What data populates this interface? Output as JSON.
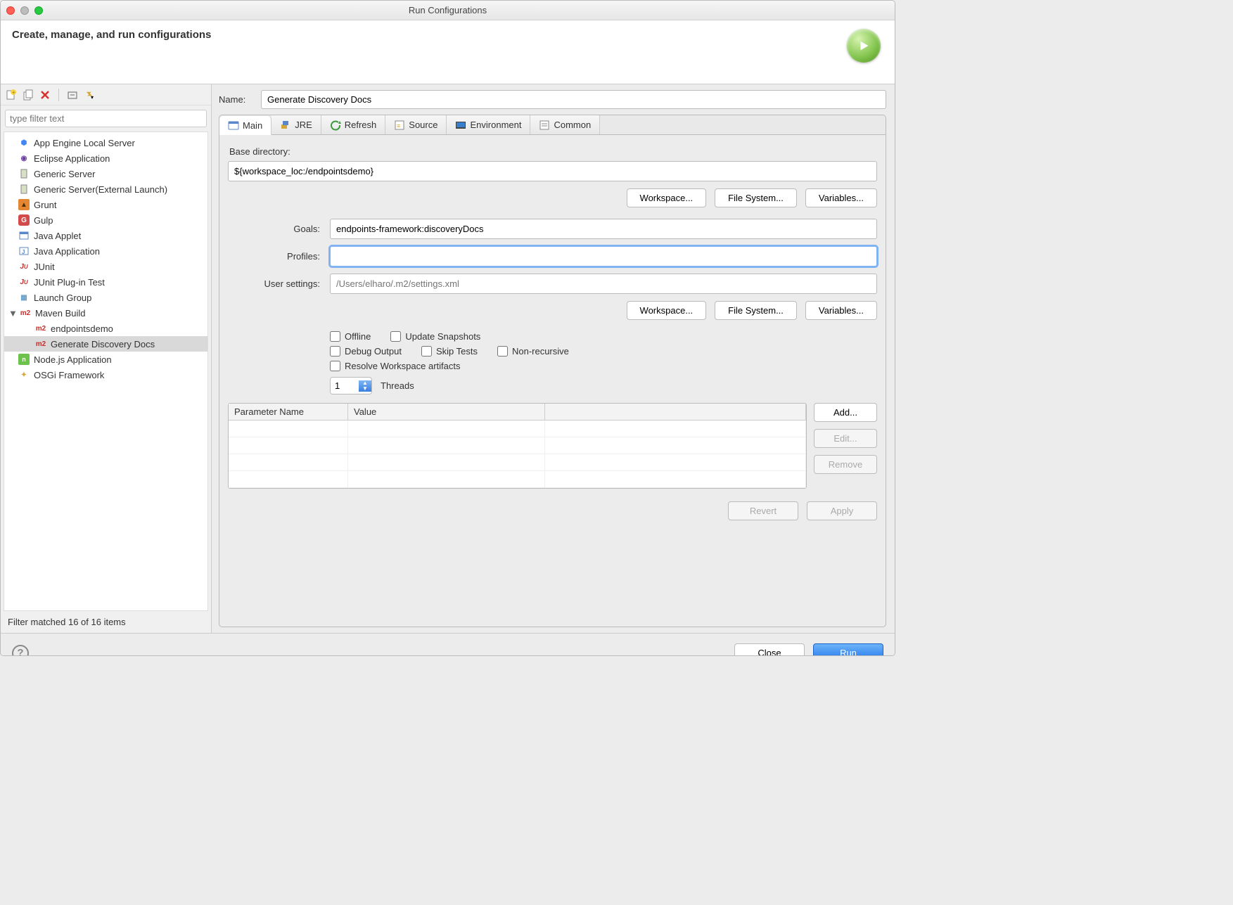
{
  "window": {
    "title": "Run Configurations"
  },
  "header": {
    "title": "Create, manage, and run configurations"
  },
  "toolbar": {
    "new": "new-config-icon",
    "duplicate": "duplicate-icon",
    "delete": "delete-icon",
    "collapse": "collapse-all-icon",
    "filter": "filter-icon"
  },
  "filter": {
    "placeholder": "type filter text"
  },
  "tree": [
    {
      "label": "App Engine Local Server",
      "icon": "gce",
      "color": "#4285f4"
    },
    {
      "label": "Eclipse Application",
      "icon": "eclipse",
      "color": "#6a3fa0"
    },
    {
      "label": "Generic Server",
      "icon": "server",
      "color": "#8ea66a"
    },
    {
      "label": "Generic Server(External Launch)",
      "icon": "server",
      "color": "#8ea66a"
    },
    {
      "label": "Grunt",
      "icon": "grunt",
      "color": "#e48632"
    },
    {
      "label": "Gulp",
      "icon": "gulp",
      "color": "#d34a4a"
    },
    {
      "label": "Java Applet",
      "icon": "applet",
      "color": "#5a87c9"
    },
    {
      "label": "Java Application",
      "icon": "javaapp",
      "color": "#5a87c9"
    },
    {
      "label": "JUnit",
      "icon": "junit",
      "color": "#c9302c"
    },
    {
      "label": "JUnit Plug-in Test",
      "icon": "junit",
      "color": "#c9302c"
    },
    {
      "label": "Launch Group",
      "icon": "launchgroup",
      "color": "#6aa0c9"
    },
    {
      "label": "Maven Build",
      "icon": "m2",
      "color": "#c9302c",
      "expanded": true,
      "children": [
        {
          "label": "endpointsdemo",
          "icon": "m2",
          "color": "#c9302c"
        },
        {
          "label": "Generate Discovery Docs",
          "icon": "m2",
          "color": "#c9302c",
          "selected": true
        }
      ]
    },
    {
      "label": "Node.js Application",
      "icon": "node",
      "color": "#6cc24a"
    },
    {
      "label": "OSGi Framework",
      "icon": "osgi",
      "color": "#d4a537"
    }
  ],
  "filter_status": "Filter matched 16 of 16 items",
  "name": {
    "label": "Name:",
    "value": "Generate Discovery Docs"
  },
  "tabs": [
    {
      "label": "Main",
      "active": true
    },
    {
      "label": "JRE"
    },
    {
      "label": "Refresh"
    },
    {
      "label": "Source"
    },
    {
      "label": "Environment"
    },
    {
      "label": "Common"
    }
  ],
  "main_tab": {
    "base_dir_label": "Base directory:",
    "base_dir_value": "${workspace_loc:/endpointsdemo}",
    "workspace_btn": "Workspace...",
    "filesystem_btn": "File System...",
    "variables_btn": "Variables...",
    "goals_label": "Goals:",
    "goals_value": "endpoints-framework:discoveryDocs",
    "profiles_label": "Profiles:",
    "profiles_value": "",
    "user_settings_label": "User settings:",
    "user_settings_placeholder": "/Users/elharo/.m2/settings.xml",
    "offline": "Offline",
    "update_snapshots": "Update Snapshots",
    "debug_output": "Debug Output",
    "skip_tests": "Skip Tests",
    "non_recursive": "Non-recursive",
    "resolve_workspace": "Resolve Workspace artifacts",
    "threads_value": "1",
    "threads_label": "Threads",
    "param_name_header": "Parameter Name",
    "param_value_header": "Value",
    "add_btn": "Add...",
    "edit_btn": "Edit...",
    "remove_btn": "Remove"
  },
  "bottom": {
    "revert": "Revert",
    "apply": "Apply"
  },
  "footer": {
    "close": "Close",
    "run": "Run"
  }
}
